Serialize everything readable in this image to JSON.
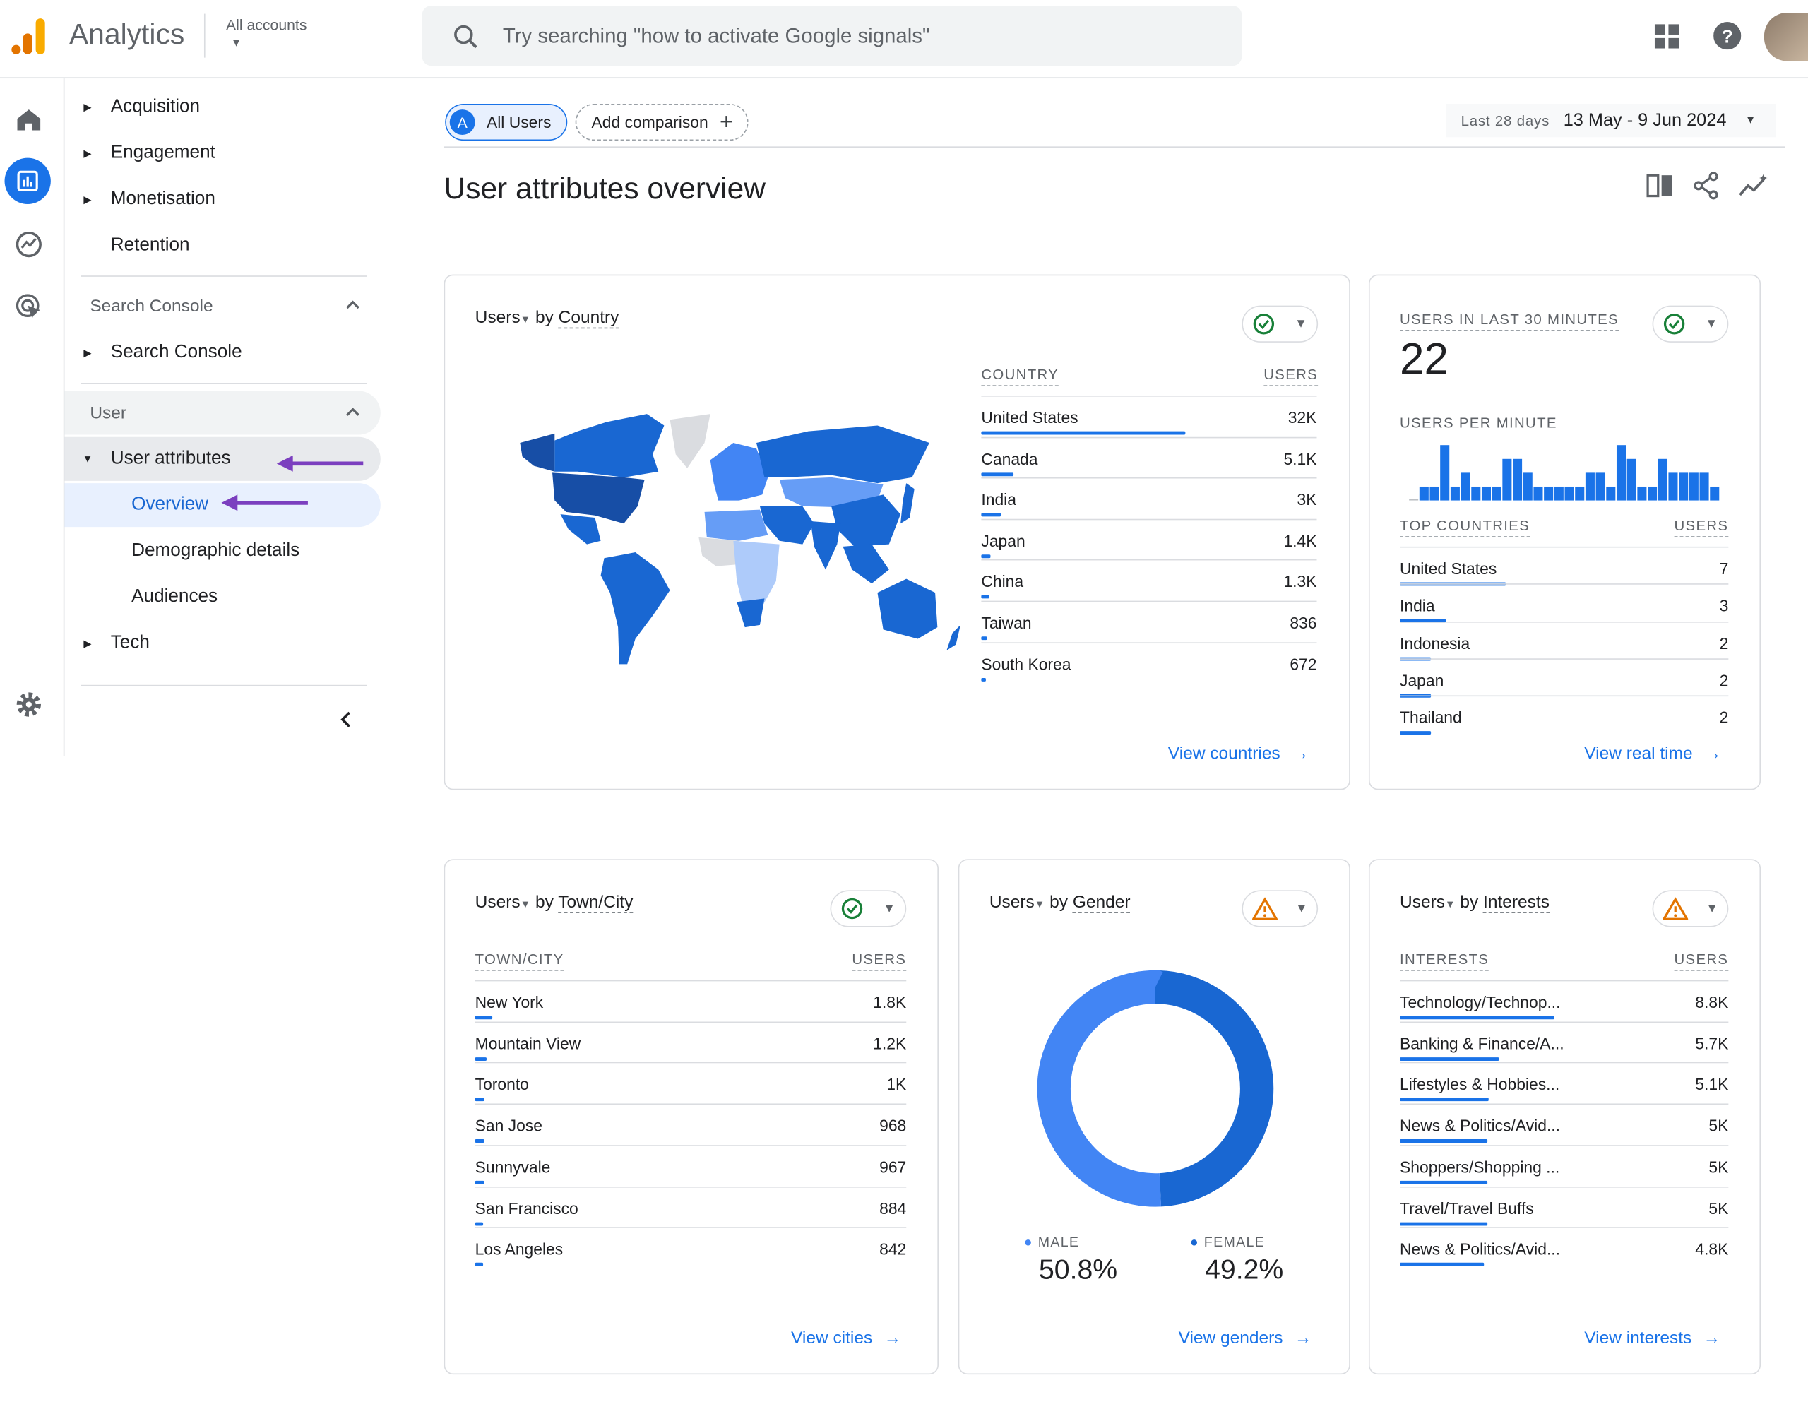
{
  "app": {
    "title": "Analytics",
    "account_label": "All accounts",
    "search_placeholder": "Try searching \"how to activate Google signals\""
  },
  "colors": {
    "accent": "#1a73e8",
    "map_dark": "#174ea6",
    "map_mid": "#1967d2",
    "map_light": "#669df6",
    "map_lighter": "#aecbfa",
    "no_data": "#dadce0",
    "annotation_arrow": "#7b3fbf",
    "male": "#4285f4",
    "female": "#1967d2"
  },
  "sidebar": {
    "items": [
      {
        "label": "Acquisition"
      },
      {
        "label": "Engagement"
      },
      {
        "label": "Monetisation"
      },
      {
        "label": "Retention"
      }
    ],
    "search_console_section": "Search Console",
    "search_console_item": "Search Console",
    "user_section": "User",
    "user_attributes": "User attributes",
    "sub_items": [
      {
        "label": "Overview",
        "active": true
      },
      {
        "label": "Demographic details"
      },
      {
        "label": "Audiences"
      }
    ],
    "tech": "Tech"
  },
  "toolbar": {
    "segment_letter": "A",
    "segment": "All Users",
    "add_comparison": "Add comparison",
    "date_range_label": "Last 28 days",
    "date_range": "13 May - 9 Jun 2024"
  },
  "page_title": "User attributes overview",
  "country_card": {
    "metric": "Users",
    "by": "by",
    "dimension": "Country",
    "col1": "COUNTRY",
    "col2": "USERS",
    "rows": [
      {
        "name": "United States",
        "value": "32K",
        "share": 1.0
      },
      {
        "name": "Canada",
        "value": "5.1K",
        "share": 0.16
      },
      {
        "name": "India",
        "value": "3K",
        "share": 0.094
      },
      {
        "name": "Japan",
        "value": "1.4K",
        "share": 0.044
      },
      {
        "name": "China",
        "value": "1.3K",
        "share": 0.041
      },
      {
        "name": "Taiwan",
        "value": "836",
        "share": 0.026
      },
      {
        "name": "South Korea",
        "value": "672",
        "share": 0.021
      }
    ],
    "link": "View countries"
  },
  "realtime_card": {
    "title": "USERS IN LAST 30 MINUTES",
    "value": "22",
    "per_minute_label": "USERS PER MINUTE",
    "per_minute": [
      0,
      1,
      1,
      4,
      1,
      2,
      1,
      1,
      1,
      3,
      3,
      2,
      1,
      1,
      1,
      1,
      1,
      2,
      2,
      1,
      4,
      3,
      1,
      1,
      3,
      2,
      2,
      2,
      2,
      1
    ],
    "col1": "TOP COUNTRIES",
    "col2": "USERS",
    "rows": [
      {
        "name": "United States",
        "value": "7",
        "share": 1.0
      },
      {
        "name": "India",
        "value": "3",
        "share": 0.43
      },
      {
        "name": "Indonesia",
        "value": "2",
        "share": 0.29
      },
      {
        "name": "Japan",
        "value": "2",
        "share": 0.29
      },
      {
        "name": "Thailand",
        "value": "2",
        "share": 0.29
      }
    ],
    "link": "View real time"
  },
  "city_card": {
    "metric": "Users",
    "by": "by",
    "dimension": "Town/City",
    "col1": "TOWN/CITY",
    "col2": "USERS",
    "rows": [
      {
        "name": "New York",
        "value": "1.8K",
        "share": 0.04
      },
      {
        "name": "Mountain View",
        "value": "1.2K",
        "share": 0.027
      },
      {
        "name": "Toronto",
        "value": "1K",
        "share": 0.022
      },
      {
        "name": "San Jose",
        "value": "968",
        "share": 0.021
      },
      {
        "name": "Sunnyvale",
        "value": "967",
        "share": 0.021
      },
      {
        "name": "San Francisco",
        "value": "884",
        "share": 0.019
      },
      {
        "name": "Los Angeles",
        "value": "842",
        "share": 0.018
      }
    ],
    "link": "View cities"
  },
  "gender_card": {
    "metric": "Users",
    "by": "by",
    "dimension": "Gender",
    "segments": [
      {
        "label": "MALE",
        "value": "50.8%",
        "pct": 50.8
      },
      {
        "label": "FEMALE",
        "value": "49.2%",
        "pct": 49.2
      }
    ],
    "link": "View genders"
  },
  "interests_card": {
    "metric": "Users",
    "by": "by",
    "dimension": "Interests",
    "col1": "INTERESTS",
    "col2": "USERS",
    "rows": [
      {
        "name": "Technology/Technop...",
        "value": "8.8K",
        "share": 0.47
      },
      {
        "name": "Banking & Finance/A...",
        "value": "5.7K",
        "share": 0.3
      },
      {
        "name": "Lifestyles & Hobbies...",
        "value": "5.1K",
        "share": 0.27
      },
      {
        "name": "News & Politics/Avid...",
        "value": "5K",
        "share": 0.265
      },
      {
        "name": "Shoppers/Shopping ...",
        "value": "5K",
        "share": 0.265
      },
      {
        "name": "Travel/Travel Buffs",
        "value": "5K",
        "share": 0.265
      },
      {
        "name": "News & Politics/Avid...",
        "value": "4.8K",
        "share": 0.255
      }
    ],
    "link": "View interests"
  }
}
